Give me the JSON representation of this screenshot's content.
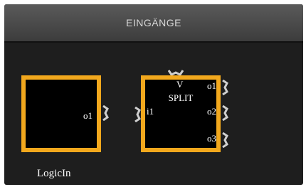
{
  "panel": {
    "title": "EINGÄNGE"
  },
  "blocks": [
    {
      "name": "logicin",
      "caption": "LogicIn",
      "outputs": [
        "o1"
      ]
    },
    {
      "name": "split",
      "title": "SPLIT",
      "inputs": [
        "i1",
        "V"
      ],
      "outputs": [
        "o1",
        "o2",
        "o3"
      ]
    }
  ],
  "colors": {
    "block_border": "#f2a81d",
    "block_fill": "#000000",
    "connector": "#cfcfcf"
  }
}
